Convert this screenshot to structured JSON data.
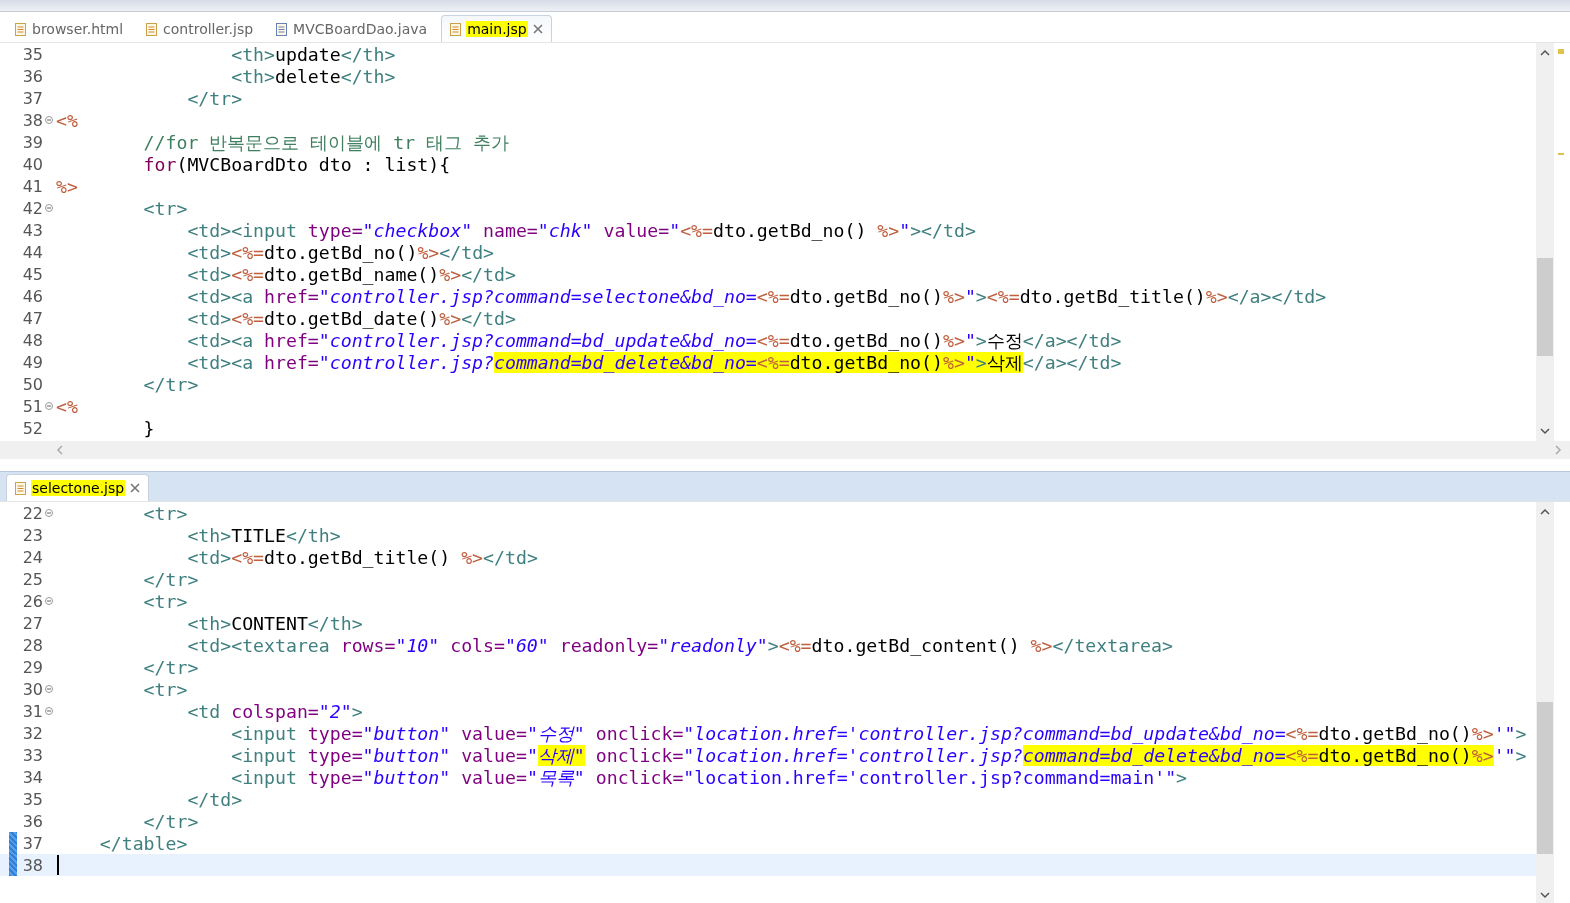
{
  "top_editor": {
    "tabs": [
      {
        "label": "browser.html",
        "kind": "html",
        "selected": false,
        "highlighted": false
      },
      {
        "label": "controller.jsp",
        "kind": "jsp",
        "selected": false,
        "highlighted": false
      },
      {
        "label": "MVCBoardDao.java",
        "kind": "java",
        "selected": false,
        "highlighted": false
      },
      {
        "label": "main.jsp",
        "kind": "jsp",
        "selected": true,
        "highlighted": true
      }
    ],
    "lines": [
      {
        "number": "35",
        "foldable": false,
        "changed": false,
        "current": false,
        "tokens": [
          {
            "kind": "tag",
            "text": "                <th>",
            "highlighted": false
          },
          {
            "kind": "text",
            "text": "update",
            "highlighted": false
          },
          {
            "kind": "tag",
            "text": "</th>",
            "highlighted": false
          }
        ]
      },
      {
        "number": "36",
        "foldable": false,
        "changed": false,
        "current": false,
        "tokens": [
          {
            "kind": "tag",
            "text": "                <th>",
            "highlighted": false
          },
          {
            "kind": "text",
            "text": "delete",
            "highlighted": false
          },
          {
            "kind": "tag",
            "text": "</th>",
            "highlighted": false
          }
        ]
      },
      {
        "number": "37",
        "foldable": false,
        "changed": false,
        "current": false,
        "tokens": [
          {
            "kind": "tag",
            "text": "            </tr>",
            "highlighted": false
          }
        ]
      },
      {
        "number": "38",
        "foldable": true,
        "changed": false,
        "current": false,
        "tokens": [
          {
            "kind": "jsp",
            "text": "<%",
            "highlighted": false
          }
        ]
      },
      {
        "number": "39",
        "foldable": false,
        "changed": false,
        "current": false,
        "tokens": [
          {
            "kind": "comment",
            "text": "        //for 반복문으로 테이블에 tr 태그 추가",
            "highlighted": false
          }
        ]
      },
      {
        "number": "40",
        "foldable": false,
        "changed": false,
        "current": false,
        "tokens": [
          {
            "kind": "keyword",
            "text": "        for",
            "highlighted": false
          },
          {
            "kind": "text",
            "text": "(MVCBoardDto dto : list){",
            "highlighted": false
          }
        ]
      },
      {
        "number": "41",
        "foldable": false,
        "changed": false,
        "current": false,
        "tokens": [
          {
            "kind": "jsp",
            "text": "%>",
            "highlighted": false
          }
        ]
      },
      {
        "number": "42",
        "foldable": true,
        "changed": false,
        "current": false,
        "tokens": [
          {
            "kind": "tag",
            "text": "        <tr>",
            "highlighted": false
          }
        ]
      },
      {
        "number": "43",
        "foldable": false,
        "changed": false,
        "current": false,
        "tokens": [
          {
            "kind": "tag",
            "text": "            <td><input ",
            "highlighted": false
          },
          {
            "kind": "attr",
            "text": "type=",
            "highlighted": false
          },
          {
            "kind": "string",
            "text": "\"checkbox\" ",
            "highlighted": false
          },
          {
            "kind": "attr",
            "text": "name=",
            "highlighted": false
          },
          {
            "kind": "string",
            "text": "\"chk\" ",
            "highlighted": false
          },
          {
            "kind": "attr",
            "text": "value=",
            "highlighted": false
          },
          {
            "kind": "string",
            "text": "\"",
            "highlighted": false
          },
          {
            "kind": "jsp",
            "text": "<%=",
            "highlighted": false
          },
          {
            "kind": "text",
            "text": "dto.getBd_no() ",
            "highlighted": false
          },
          {
            "kind": "jsp",
            "text": "%>",
            "highlighted": false
          },
          {
            "kind": "string",
            "text": "\"",
            "highlighted": false
          },
          {
            "kind": "tag",
            "text": "></td>",
            "highlighted": false
          }
        ]
      },
      {
        "number": "44",
        "foldable": false,
        "changed": false,
        "current": false,
        "tokens": [
          {
            "kind": "tag",
            "text": "            <td>",
            "highlighted": false
          },
          {
            "kind": "jsp",
            "text": "<%=",
            "highlighted": false
          },
          {
            "kind": "text",
            "text": "dto.getBd_no()",
            "highlighted": false
          },
          {
            "kind": "jsp",
            "text": "%>",
            "highlighted": false
          },
          {
            "kind": "tag",
            "text": "</td>",
            "highlighted": false
          }
        ]
      },
      {
        "number": "45",
        "foldable": false,
        "changed": false,
        "current": false,
        "tokens": [
          {
            "kind": "tag",
            "text": "            <td>",
            "highlighted": false
          },
          {
            "kind": "jsp",
            "text": "<%=",
            "highlighted": false
          },
          {
            "kind": "text",
            "text": "dto.getBd_name()",
            "highlighted": false
          },
          {
            "kind": "jsp",
            "text": "%>",
            "highlighted": false
          },
          {
            "kind": "tag",
            "text": "</td>",
            "highlighted": false
          }
        ]
      },
      {
        "number": "46",
        "foldable": false,
        "changed": false,
        "current": false,
        "tokens": [
          {
            "kind": "tag",
            "text": "            <td><a ",
            "highlighted": false
          },
          {
            "kind": "attr",
            "text": "href=",
            "highlighted": false
          },
          {
            "kind": "string",
            "text": "\"controller.jsp?command=selectone&bd_no=",
            "highlighted": false
          },
          {
            "kind": "jsp",
            "text": "<%=",
            "highlighted": false
          },
          {
            "kind": "text",
            "text": "dto.getBd_no()",
            "highlighted": false
          },
          {
            "kind": "jsp",
            "text": "%>",
            "highlighted": false
          },
          {
            "kind": "string",
            "text": "\"",
            "highlighted": false
          },
          {
            "kind": "tag",
            "text": ">",
            "highlighted": false
          },
          {
            "kind": "jsp",
            "text": "<%=",
            "highlighted": false
          },
          {
            "kind": "text",
            "text": "dto.getBd_title()",
            "highlighted": false
          },
          {
            "kind": "jsp",
            "text": "%>",
            "highlighted": false
          },
          {
            "kind": "tag",
            "text": "</a></td>",
            "highlighted": false
          }
        ]
      },
      {
        "number": "47",
        "foldable": false,
        "changed": false,
        "current": false,
        "tokens": [
          {
            "kind": "tag",
            "text": "            <td>",
            "highlighted": false
          },
          {
            "kind": "jsp",
            "text": "<%=",
            "highlighted": false
          },
          {
            "kind": "text",
            "text": "dto.getBd_date()",
            "highlighted": false
          },
          {
            "kind": "jsp",
            "text": "%>",
            "highlighted": false
          },
          {
            "kind": "tag",
            "text": "</td>",
            "highlighted": false
          }
        ]
      },
      {
        "number": "48",
        "foldable": false,
        "changed": false,
        "current": false,
        "tokens": [
          {
            "kind": "tag",
            "text": "            <td><a ",
            "highlighted": false
          },
          {
            "kind": "attr",
            "text": "href=",
            "highlighted": false
          },
          {
            "kind": "string",
            "text": "\"controller.jsp?command=bd_update&bd_no=",
            "highlighted": false
          },
          {
            "kind": "jsp",
            "text": "<%=",
            "highlighted": false
          },
          {
            "kind": "text",
            "text": "dto.getBd_no()",
            "highlighted": false
          },
          {
            "kind": "jsp",
            "text": "%>",
            "highlighted": false
          },
          {
            "kind": "string",
            "text": "\"",
            "highlighted": false
          },
          {
            "kind": "tag",
            "text": ">",
            "highlighted": false
          },
          {
            "kind": "text",
            "text": "수정",
            "highlighted": false
          },
          {
            "kind": "tag",
            "text": "</a></td>",
            "highlighted": false
          }
        ]
      },
      {
        "number": "49",
        "foldable": false,
        "changed": false,
        "current": false,
        "tokens": [
          {
            "kind": "tag",
            "text": "            <td><a ",
            "highlighted": false
          },
          {
            "kind": "attr",
            "text": "href=",
            "highlighted": false
          },
          {
            "kind": "string",
            "text": "\"controller.jsp?",
            "highlighted": false
          },
          {
            "kind": "string",
            "text": "command=bd_delete&bd_no=",
            "highlighted": true
          },
          {
            "kind": "jsp",
            "text": "<%=",
            "highlighted": true
          },
          {
            "kind": "text",
            "text": "dto.getBd_no()",
            "highlighted": true
          },
          {
            "kind": "jsp",
            "text": "%>",
            "highlighted": true
          },
          {
            "kind": "string",
            "text": "\"",
            "highlighted": true
          },
          {
            "kind": "tag",
            "text": ">",
            "highlighted": true
          },
          {
            "kind": "text",
            "text": "삭제",
            "highlighted": true
          },
          {
            "kind": "tag",
            "text": "</a></td>",
            "highlighted": false
          }
        ]
      },
      {
        "number": "50",
        "foldable": false,
        "changed": false,
        "current": false,
        "tokens": [
          {
            "kind": "tag",
            "text": "        </tr>",
            "highlighted": false
          }
        ]
      },
      {
        "number": "51",
        "foldable": true,
        "changed": false,
        "current": false,
        "tokens": [
          {
            "kind": "jsp",
            "text": "<%",
            "highlighted": false
          }
        ]
      },
      {
        "number": "52",
        "foldable": false,
        "changed": false,
        "current": false,
        "tokens": [
          {
            "kind": "text",
            "text": "        }",
            "highlighted": false
          }
        ]
      }
    ]
  },
  "bottom_editor": {
    "tabs": [
      {
        "label": "selectone.jsp",
        "kind": "jsp",
        "selected": true,
        "highlighted": true
      }
    ],
    "lines": [
      {
        "number": "22",
        "foldable": true,
        "changed": false,
        "current": false,
        "tokens": [
          {
            "kind": "tag",
            "text": "        <tr>",
            "highlighted": false
          }
        ]
      },
      {
        "number": "23",
        "foldable": false,
        "changed": false,
        "current": false,
        "tokens": [
          {
            "kind": "tag",
            "text": "            <th>",
            "highlighted": false
          },
          {
            "kind": "text",
            "text": "TITLE",
            "highlighted": false
          },
          {
            "kind": "tag",
            "text": "</th>",
            "highlighted": false
          }
        ]
      },
      {
        "number": "24",
        "foldable": false,
        "changed": false,
        "current": false,
        "tokens": [
          {
            "kind": "tag",
            "text": "            <td>",
            "highlighted": false
          },
          {
            "kind": "jsp",
            "text": "<%=",
            "highlighted": false
          },
          {
            "kind": "text",
            "text": "dto.getBd_title() ",
            "highlighted": false
          },
          {
            "kind": "jsp",
            "text": "%>",
            "highlighted": false
          },
          {
            "kind": "tag",
            "text": "</td>",
            "highlighted": false
          }
        ]
      },
      {
        "number": "25",
        "foldable": false,
        "changed": false,
        "current": false,
        "tokens": [
          {
            "kind": "tag",
            "text": "        </tr>",
            "highlighted": false
          }
        ]
      },
      {
        "number": "26",
        "foldable": true,
        "changed": false,
        "current": false,
        "tokens": [
          {
            "kind": "tag",
            "text": "        <tr>",
            "highlighted": false
          }
        ]
      },
      {
        "number": "27",
        "foldable": false,
        "changed": false,
        "current": false,
        "tokens": [
          {
            "kind": "tag",
            "text": "            <th>",
            "highlighted": false
          },
          {
            "kind": "text",
            "text": "CONTENT",
            "highlighted": false
          },
          {
            "kind": "tag",
            "text": "</th>",
            "highlighted": false
          }
        ]
      },
      {
        "number": "28",
        "foldable": false,
        "changed": false,
        "current": false,
        "tokens": [
          {
            "kind": "tag",
            "text": "            <td><textarea ",
            "highlighted": false
          },
          {
            "kind": "attr",
            "text": "rows=",
            "highlighted": false
          },
          {
            "kind": "string",
            "text": "\"10\" ",
            "highlighted": false
          },
          {
            "kind": "attr",
            "text": "cols=",
            "highlighted": false
          },
          {
            "kind": "string",
            "text": "\"60\" ",
            "highlighted": false
          },
          {
            "kind": "attr",
            "text": "readonly=",
            "highlighted": false
          },
          {
            "kind": "string",
            "text": "\"readonly\"",
            "highlighted": false
          },
          {
            "kind": "tag",
            "text": ">",
            "highlighted": false
          },
          {
            "kind": "jsp",
            "text": "<%=",
            "highlighted": false
          },
          {
            "kind": "text",
            "text": "dto.getBd_content() ",
            "highlighted": false
          },
          {
            "kind": "jsp",
            "text": "%>",
            "highlighted": false
          },
          {
            "kind": "tag",
            "text": "</textarea>",
            "highlighted": false
          }
        ]
      },
      {
        "number": "29",
        "foldable": false,
        "changed": false,
        "current": false,
        "tokens": [
          {
            "kind": "tag",
            "text": "        </tr>",
            "highlighted": false
          }
        ]
      },
      {
        "number": "30",
        "foldable": true,
        "changed": false,
        "current": false,
        "tokens": [
          {
            "kind": "tag",
            "text": "        <tr>",
            "highlighted": false
          }
        ]
      },
      {
        "number": "31",
        "foldable": true,
        "changed": false,
        "current": false,
        "tokens": [
          {
            "kind": "tag",
            "text": "            <td ",
            "highlighted": false
          },
          {
            "kind": "attr",
            "text": "colspan=",
            "highlighted": false
          },
          {
            "kind": "string",
            "text": "\"2\"",
            "highlighted": false
          },
          {
            "kind": "tag",
            "text": ">",
            "highlighted": false
          }
        ]
      },
      {
        "number": "32",
        "foldable": false,
        "changed": false,
        "current": false,
        "tokens": [
          {
            "kind": "tag",
            "text": "                <input ",
            "highlighted": false
          },
          {
            "kind": "attr",
            "text": "type=",
            "highlighted": false
          },
          {
            "kind": "string",
            "text": "\"button\" ",
            "highlighted": false
          },
          {
            "kind": "attr",
            "text": "value=",
            "highlighted": false
          },
          {
            "kind": "string",
            "text": "\"수정\" ",
            "highlighted": false
          },
          {
            "kind": "attr",
            "text": "onclick=",
            "highlighted": false
          },
          {
            "kind": "string",
            "text": "\"location.href='controller.jsp?command=bd_update&bd_no=",
            "highlighted": false
          },
          {
            "kind": "jsp",
            "text": "<%=",
            "highlighted": false
          },
          {
            "kind": "text",
            "text": "dto.getBd_no()",
            "highlighted": false
          },
          {
            "kind": "jsp",
            "text": "%>",
            "highlighted": false
          },
          {
            "kind": "string",
            "text": "'\"",
            "highlighted": false
          },
          {
            "kind": "tag",
            "text": ">",
            "highlighted": false
          }
        ]
      },
      {
        "number": "33",
        "foldable": false,
        "changed": false,
        "current": false,
        "tokens": [
          {
            "kind": "tag",
            "text": "                <input ",
            "highlighted": false
          },
          {
            "kind": "attr",
            "text": "type=",
            "highlighted": false
          },
          {
            "kind": "string",
            "text": "\"button\" ",
            "highlighted": false
          },
          {
            "kind": "attr",
            "text": "value=",
            "highlighted": false
          },
          {
            "kind": "string",
            "text": "\"",
            "highlighted": false
          },
          {
            "kind": "string",
            "text": "삭제\"",
            "highlighted": true
          },
          {
            "kind": "attr",
            "text": " onclick=",
            "highlighted": false
          },
          {
            "kind": "string",
            "text": "\"location.href='controller.jsp?",
            "highlighted": false
          },
          {
            "kind": "string",
            "text": "command=bd_delete&bd_no=",
            "highlighted": true
          },
          {
            "kind": "jsp",
            "text": "<%=",
            "highlighted": true
          },
          {
            "kind": "text",
            "text": "dto.getBd_no()",
            "highlighted": true
          },
          {
            "kind": "jsp",
            "text": "%>",
            "highlighted": true
          },
          {
            "kind": "string",
            "text": "'\"",
            "highlighted": false
          },
          {
            "kind": "tag",
            "text": ">",
            "highlighted": false
          }
        ]
      },
      {
        "number": "34",
        "foldable": false,
        "changed": false,
        "current": false,
        "tokens": [
          {
            "kind": "tag",
            "text": "                <input ",
            "highlighted": false
          },
          {
            "kind": "attr",
            "text": "type=",
            "highlighted": false
          },
          {
            "kind": "string",
            "text": "\"button\" ",
            "highlighted": false
          },
          {
            "kind": "attr",
            "text": "value=",
            "highlighted": false
          },
          {
            "kind": "string",
            "text": "\"목록\" ",
            "highlighted": false
          },
          {
            "kind": "attr",
            "text": "onclick=",
            "highlighted": false
          },
          {
            "kind": "string_plain",
            "text": "\"location.href='controller.jsp?command=main'\"",
            "highlighted": false
          },
          {
            "kind": "tag",
            "text": ">",
            "highlighted": false
          }
        ]
      },
      {
        "number": "35",
        "foldable": false,
        "changed": false,
        "current": false,
        "tokens": [
          {
            "kind": "tag",
            "text": "            </td>",
            "highlighted": false
          }
        ]
      },
      {
        "number": "36",
        "foldable": false,
        "changed": false,
        "current": false,
        "tokens": [
          {
            "kind": "tag",
            "text": "        </tr>",
            "highlighted": false
          }
        ]
      },
      {
        "number": "37",
        "foldable": false,
        "changed": true,
        "current": false,
        "tokens": [
          {
            "kind": "tag",
            "text": "    </table>",
            "highlighted": false
          }
        ]
      },
      {
        "number": "38",
        "foldable": false,
        "changed": true,
        "current": true
      }
    ]
  }
}
